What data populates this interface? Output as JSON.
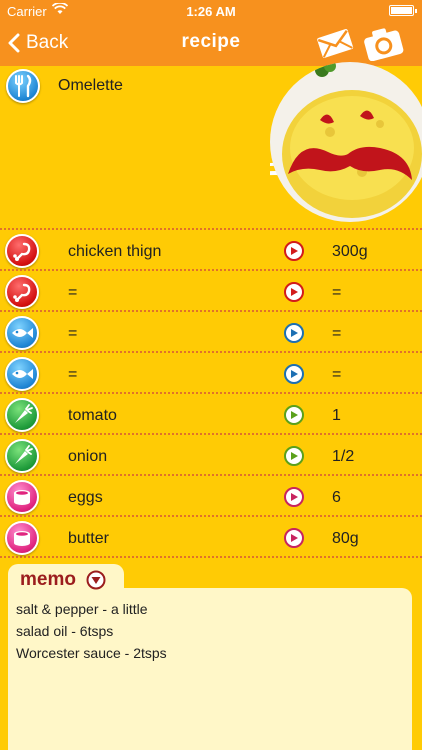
{
  "status_bar": {
    "carrier": "Carrier",
    "time": "1:26 AM"
  },
  "nav": {
    "back_label": "Back",
    "title": "recipe"
  },
  "recipe": {
    "name": "Omelette"
  },
  "ingredients": [
    {
      "name": "chicken thign",
      "qty": "300g",
      "category": "meat-icon"
    },
    {
      "name": "=",
      "qty": "=",
      "category": "meat-icon"
    },
    {
      "name": "=",
      "qty": "=",
      "category": "fish-icon"
    },
    {
      "name": "=",
      "qty": "=",
      "category": "fish-icon"
    },
    {
      "name": "tomato",
      "qty": "1",
      "category": "vegetable-icon"
    },
    {
      "name": "onion",
      "qty": "1/2",
      "category": "vegetable-icon"
    },
    {
      "name": "eggs",
      "qty": "6",
      "category": "egg-dairy-icon"
    },
    {
      "name": "butter",
      "qty": "80g",
      "category": "egg-dairy-icon"
    }
  ],
  "memo": {
    "label": "memo",
    "lines": [
      "salt & pepper - a little",
      "salad oil - 6tsps",
      "Worcester sauce - 2tsps"
    ]
  },
  "colors": {
    "nav_bar": "#f7911e",
    "background": "#ffcb05",
    "memo_background": "#fff7c8",
    "memo_label": "#9b1d1d",
    "meat": "#d31010",
    "fish": "#1f86d4",
    "vegetable": "#1e9b3a",
    "egg_dairy": "#e0247f"
  }
}
